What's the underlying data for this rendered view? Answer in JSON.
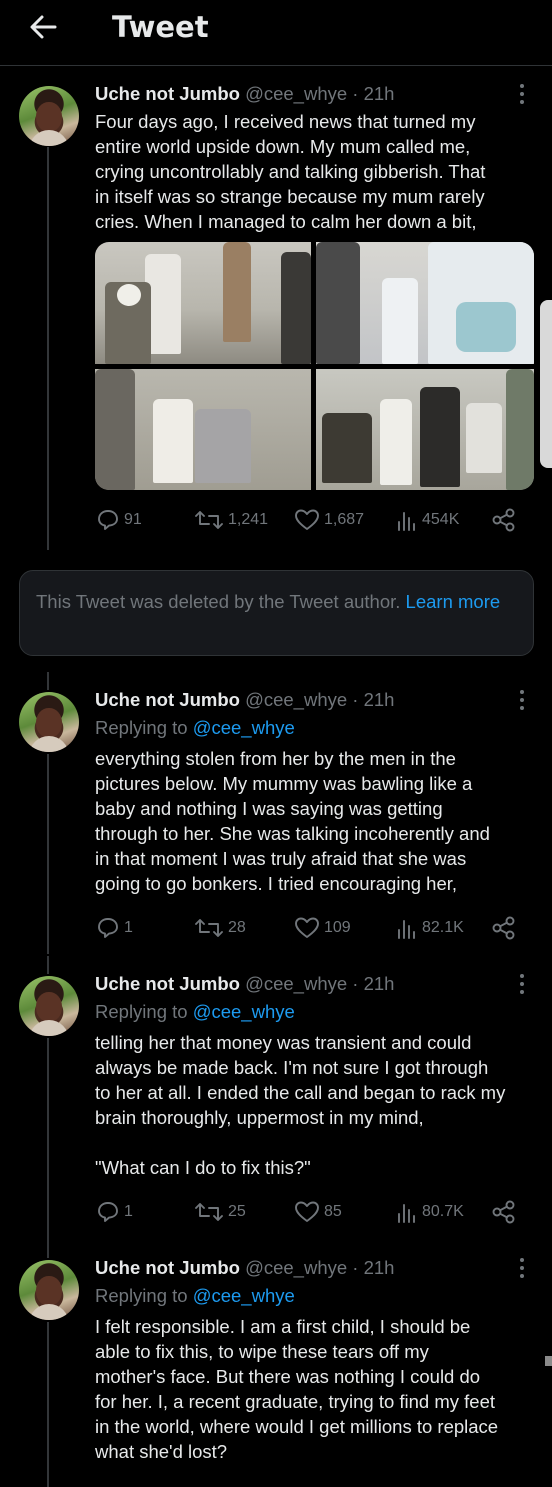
{
  "header": {
    "title": "Tweet"
  },
  "tweets": [
    {
      "name": "Uche not Jumbo",
      "handle": "@cee_whye",
      "time": "21h",
      "replying_label": "",
      "replying_handle": "",
      "text": "Four days ago, I received news that turned my\nentire world upside down. My mum called me,\ncrying uncontrollably and talking gibberish. That\nin itself was so strange because my mum rarely\ncries. When I managed to calm her down a bit,",
      "stats": {
        "replies": "91",
        "retweets": "1,241",
        "likes": "1,687",
        "views": "454K"
      }
    },
    {
      "name": "Uche not Jumbo",
      "handle": "@cee_whye",
      "time": "21h",
      "replying_label": "Replying to",
      "replying_handle": "@cee_whye",
      "text": "everything stolen from her by the men in the\npictures below. My mummy was bawling like a\nbaby and nothing I was saying was getting\nthrough to her. She was talking incoherently and\nin that moment I was truly afraid that she was\ngoing to go bonkers. I tried encouraging her,",
      "stats": {
        "replies": "1",
        "retweets": "28",
        "likes": "109",
        "views": "82.1K"
      }
    },
    {
      "name": "Uche not Jumbo",
      "handle": "@cee_whye",
      "time": "21h",
      "replying_label": "Replying to",
      "replying_handle": "@cee_whye",
      "text": "telling her that money was transient and could\nalways be made back. I'm not sure I got through\nto her at all. I ended the call and began to rack my\nbrain thoroughly, uppermost in my mind,\n\n\"What can I do to fix this?\"",
      "stats": {
        "replies": "1",
        "retweets": "25",
        "likes": "85",
        "views": "80.7K"
      }
    },
    {
      "name": "Uche not Jumbo",
      "handle": "@cee_whye",
      "time": "21h",
      "replying_label": "Replying to",
      "replying_handle": "@cee_whye",
      "text": "I felt responsible. I am a first child, I should be\nable to fix this, to wipe these tears off my\nmother's face. But there was nothing I could do\nfor her. I, a recent graduate, trying to find my feet\nin the world, where would I get millions to replace\nwhat she'd lost?",
      "stats": {
        "replies": "",
        "retweets": "",
        "likes": "",
        "views": ""
      }
    }
  ],
  "deleted_notice": {
    "text": "This Tweet was deleted by the Tweet author. ",
    "link": "Learn more"
  },
  "icons": {
    "back": "arrow-left-icon",
    "more": "more-vertical-icon",
    "reply": "reply-bubble-icon",
    "retweet": "retweet-icon",
    "like": "heart-icon",
    "views": "views-bar-chart-icon",
    "share": "share-icon"
  },
  "colors": {
    "background": "#000000",
    "text": "#e7e9ea",
    "muted": "#71767b",
    "link": "#1d9bf0",
    "border": "#2f3336"
  }
}
